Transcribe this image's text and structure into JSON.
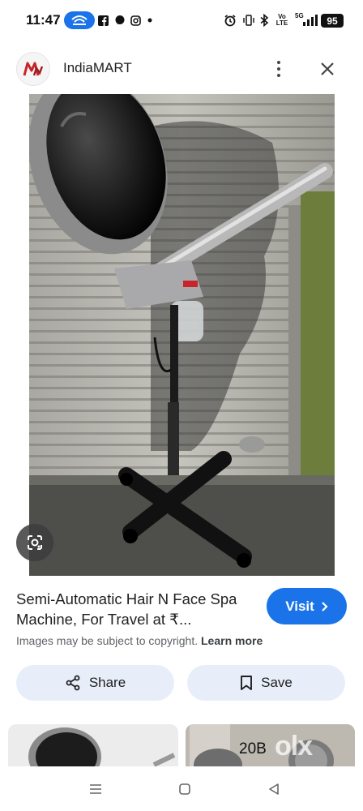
{
  "status_bar": {
    "time": "11:47",
    "indicators": [
      "hotspot-icon",
      "facebook-icon",
      "chat-icon",
      "instagram-icon",
      "dot-icon",
      "alarm-icon",
      "vibrate-icon",
      "bluetooth-icon",
      "volte-icon",
      "signal-5g-icon"
    ],
    "volte_label": "Vo LTE",
    "network_label": "5G",
    "battery": "95"
  },
  "header": {
    "site_name": "IndiaMART",
    "logo_icon": "indiamart-logo-icon",
    "menu_icon": "more-vert-icon",
    "close_icon": "close-icon"
  },
  "product": {
    "title": "Semi-Automatic Hair N Face Spa Machine, For Travel at ₹...",
    "visit_label": "Visit",
    "copyright_text": "Images may be subject to copyright.",
    "learn_more_label": "Learn more",
    "share_label": "Share",
    "save_label": "Save"
  },
  "thumbnails": [
    {
      "label": ""
    },
    {
      "label": "20B",
      "watermark": "olx"
    }
  ],
  "colors": {
    "accent": "#1a73e8",
    "pill_bg": "#e8eef9",
    "brand_red": "#c7252b"
  }
}
